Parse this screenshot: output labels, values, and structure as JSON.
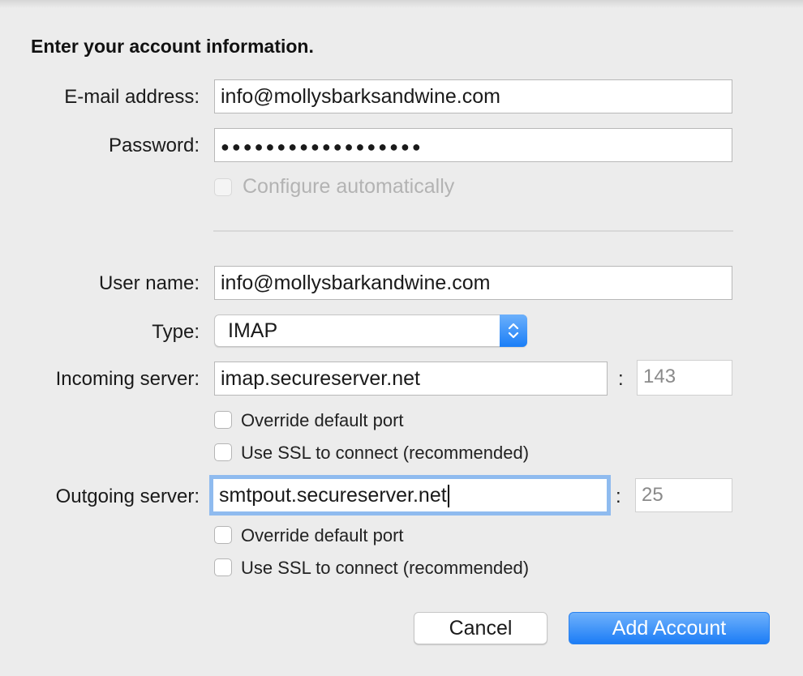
{
  "heading": "Enter your account information.",
  "account": {
    "email_label": "E-mail address:",
    "email_value": "info@mollysbarksandwine.com",
    "password_label": "Password:",
    "password_masked": "●●●●●●●●●●●●●●●●●●",
    "configure_auto_label": "Configure automatically",
    "configure_auto_checked": false,
    "configure_auto_enabled": false
  },
  "server": {
    "username_label": "User name:",
    "username_value": "info@mollysbarkandwine.com",
    "type_label": "Type:",
    "type_value": "IMAP",
    "incoming_label": "Incoming server:",
    "incoming_value": "imap.secureserver.net",
    "incoming_port": "143",
    "incoming_override_label": "Override default port",
    "incoming_ssl_label": "Use SSL to connect (recommended)",
    "outgoing_label": "Outgoing server:",
    "outgoing_value": "smtpout.secureserver.net",
    "outgoing_port": "25",
    "outgoing_override_label": "Override default port",
    "outgoing_ssl_label": "Use SSL to connect (recommended)",
    "colon": ":"
  },
  "buttons": {
    "cancel": "Cancel",
    "add_account": "Add Account"
  },
  "colors": {
    "accent": "#1a7ef7",
    "focus_ring": "#8fbbef"
  }
}
